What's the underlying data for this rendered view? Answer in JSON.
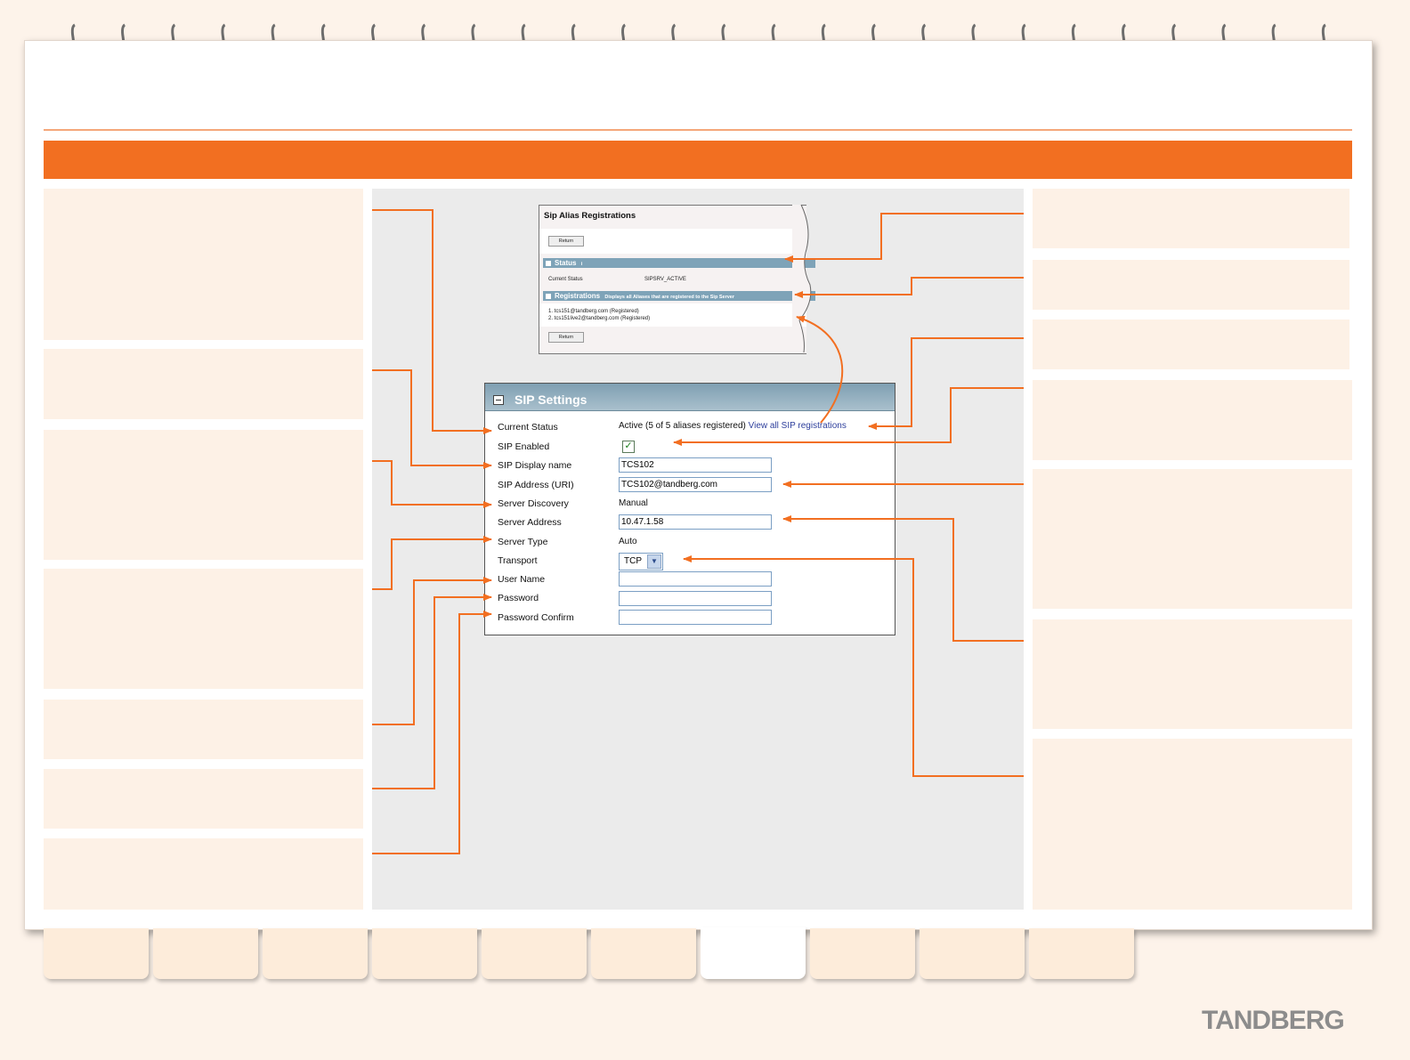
{
  "alias_registrations": {
    "title": "Sip Alias Registrations",
    "return_label": "Return",
    "status_header": "Status",
    "status_marker": "i",
    "current_status_label": "Current Status",
    "current_status_value": "SIPSRV_ACTIVE",
    "registrations_header": "Registrations",
    "registrations_subtitle": "Displays all Aliases that are registered to the Sip Server",
    "registrations": [
      "1. tcs151@tandberg.com (Registered)",
      "2. tcs151live2@tandberg.com (Registered)"
    ]
  },
  "sip_settings": {
    "title": "SIP Settings",
    "current_status_label": "Current Status",
    "current_status_value": "Active (5 of 5 aliases registered)",
    "view_registrations_link": "View all SIP registrations",
    "sip_enabled_label": "SIP Enabled",
    "sip_enabled_checked": true,
    "sip_enabled_check_glyph": "✓",
    "display_name_label": "SIP Display name",
    "display_name_value": "TCS102",
    "address_label": "SIP Address (URI)",
    "address_value": "TCS102@tandberg.com",
    "server_discovery_label": "Server Discovery",
    "server_discovery_value": "Manual",
    "server_address_label": "Server Address",
    "server_address_value": "10.47.1.58",
    "server_type_label": "Server Type",
    "server_type_value": "Auto",
    "transport_label": "Transport",
    "transport_value": "TCP",
    "transport_dropdown_glyph": "▼",
    "user_name_label": "User Name",
    "user_name_value": "",
    "password_label": "Password",
    "password_value": "",
    "password_confirm_label": "Password Confirm",
    "password_confirm_value": ""
  },
  "brand": {
    "logo_text": "TANDBERG"
  },
  "colors": {
    "accent_orange": "#f26f21",
    "panel_background": "#fdf1e6",
    "header_blue": "#7f9fb2",
    "link_blue": "#2e3f9c"
  },
  "icons": {
    "collapse": "collapse-icon",
    "checkbox": "checkbox-checked-icon",
    "dropdown": "chevron-down-icon"
  }
}
